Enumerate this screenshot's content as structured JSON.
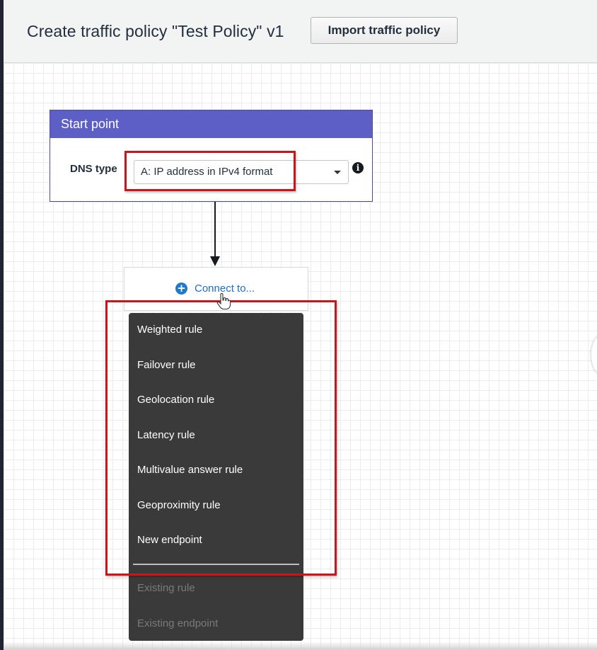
{
  "header": {
    "title": "Create traffic policy \"Test Policy\" v1",
    "import_button_label": "Import traffic policy"
  },
  "start_point": {
    "title": "Start point",
    "dns_type_label": "DNS type",
    "dns_type_value": "A: IP address in IPv4 format",
    "info_icon_glyph": "i"
  },
  "connect": {
    "label": "Connect to...",
    "plus_glyph": "+"
  },
  "menu": {
    "items": [
      {
        "label": "Weighted rule",
        "enabled": true
      },
      {
        "label": "Failover rule",
        "enabled": true
      },
      {
        "label": "Geolocation rule",
        "enabled": true
      },
      {
        "label": "Latency rule",
        "enabled": true
      },
      {
        "label": "Multivalue answer rule",
        "enabled": true
      },
      {
        "label": "Geoproximity rule",
        "enabled": true
      },
      {
        "label": "New endpoint",
        "enabled": true
      },
      {
        "label": "Existing rule",
        "enabled": false
      },
      {
        "label": "Existing endpoint",
        "enabled": false
      }
    ]
  },
  "colors": {
    "start_header": "#5e5ec7",
    "highlight": "#c8161d",
    "menu_background": "#3a3a3a",
    "link": "#1f6fbd"
  },
  "icons": [
    "info-icon",
    "plus-circle-icon",
    "hand-cursor-icon",
    "chevron-down-icon"
  ]
}
